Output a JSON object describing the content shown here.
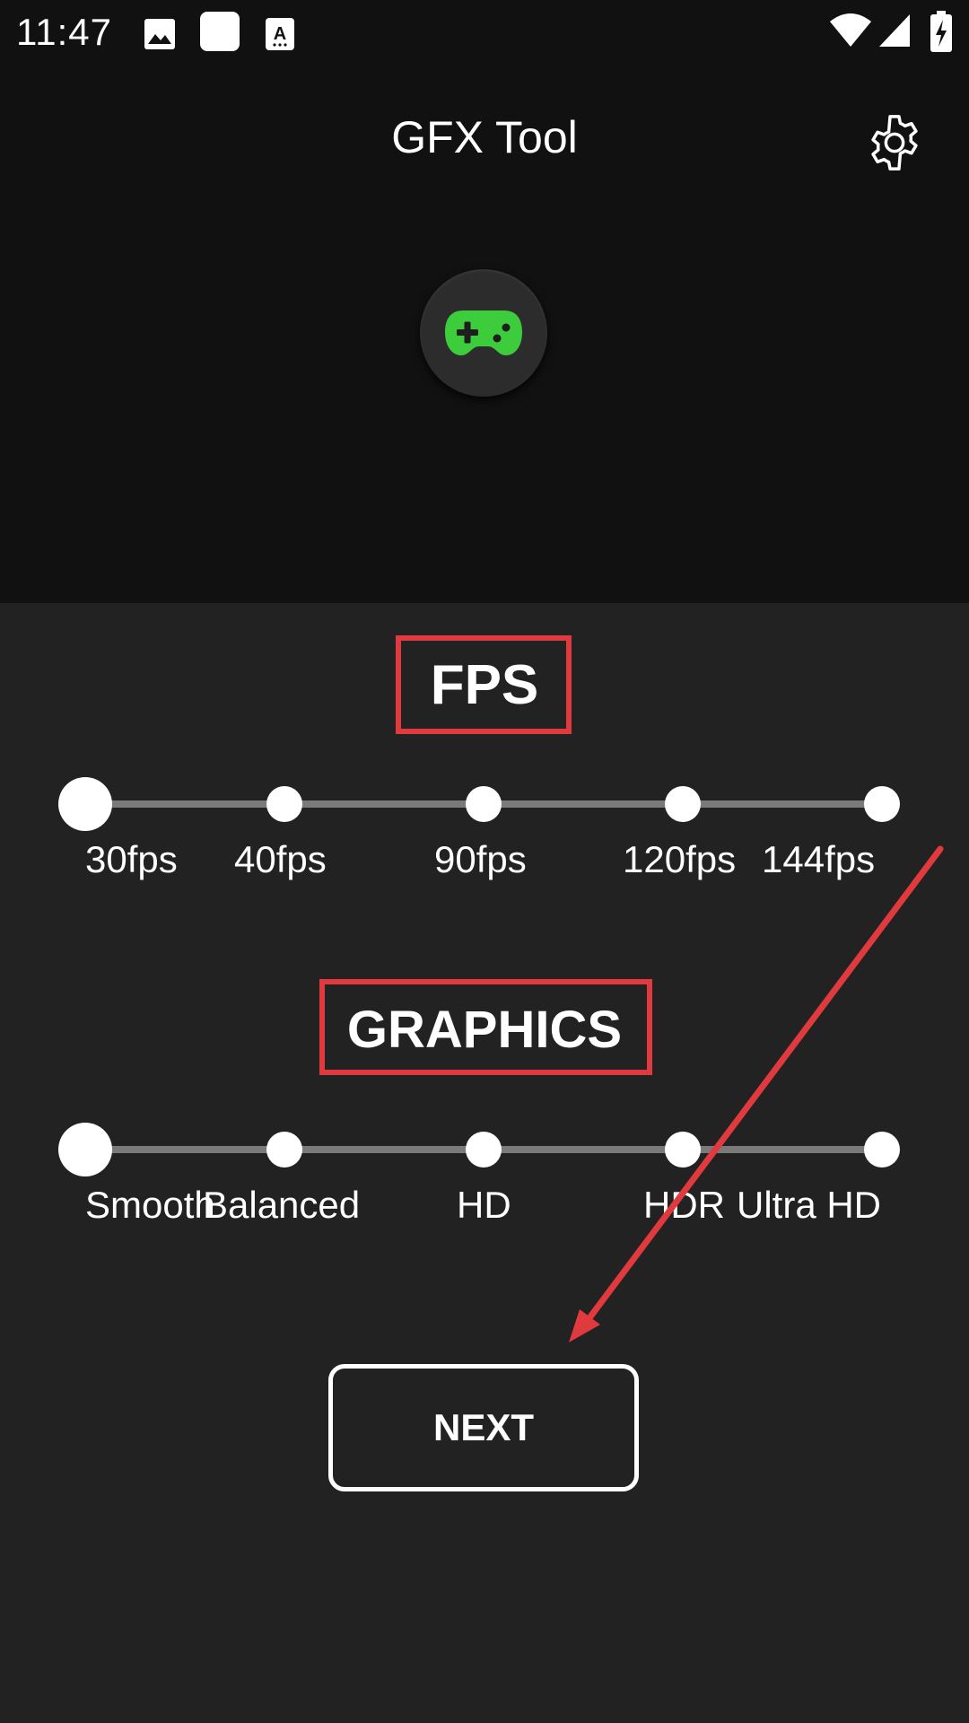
{
  "status_bar": {
    "time": "11:47",
    "left_icons": [
      "image-icon",
      "app-square-icon",
      "text-a-icon"
    ],
    "right_icons": [
      "wifi-icon",
      "signal-icon",
      "battery-charging-icon"
    ]
  },
  "header": {
    "title": "GFX Tool",
    "settings_icon": "gear-icon"
  },
  "hero": {
    "icon": "gamepad-icon",
    "icon_color": "#3ccc3c"
  },
  "fps": {
    "title": "FPS",
    "selected_index": 0,
    "options": [
      "30fps",
      "40fps",
      "90fps",
      "120fps",
      "144fps"
    ]
  },
  "graphics": {
    "title": "GRAPHICS",
    "selected_index": 0,
    "options": [
      "Smooth",
      "Balanced",
      "HD",
      "HDR",
      "Ultra HD"
    ]
  },
  "next_button": {
    "label": "NEXT"
  },
  "colors": {
    "background_top": "#111111",
    "background_main": "#222222",
    "highlight_red": "#e03a3e",
    "accent_green": "#3ccc3c"
  }
}
